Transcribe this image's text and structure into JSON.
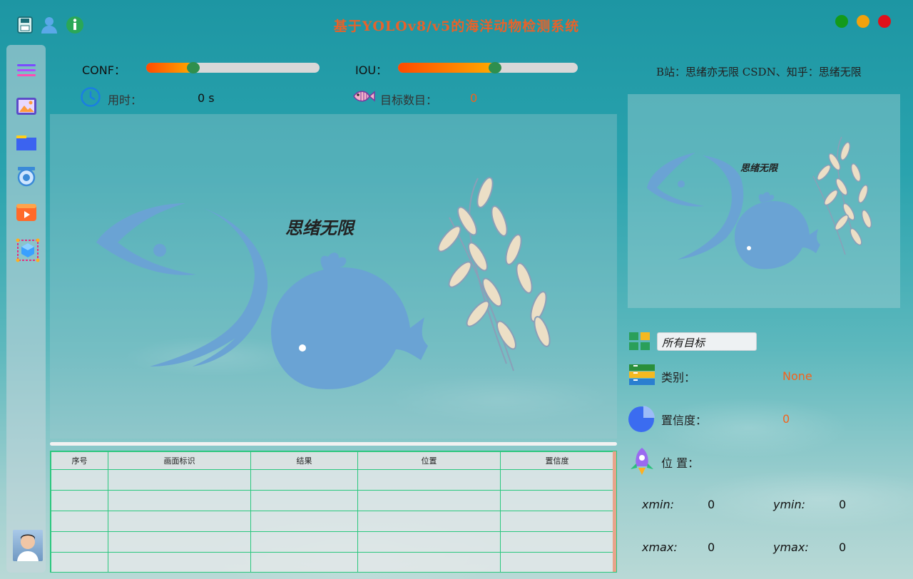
{
  "header": {
    "title": "基于YOLOv8/v5的海洋动物检测系统"
  },
  "window_controls": {
    "colors": {
      "green": "#139a1a",
      "yellow": "#f2a20c",
      "red": "#e0101a"
    }
  },
  "controls": {
    "conf_label": "CONF：",
    "conf_value": 0.27,
    "iou_label": "IOU：",
    "iou_value": 0.54,
    "time_label": "用时：",
    "time_value": "0 s",
    "count_label": "目标数目：",
    "count_value": "0"
  },
  "credit": "B站：思绪亦无限  CSDN、知乎：思绪无限",
  "watermark": "思绪无限",
  "table": {
    "headers": [
      "序号",
      "画面标识",
      "结果",
      "位置",
      "置信度"
    ],
    "row_count": 5
  },
  "detail": {
    "target_select": "所有目标",
    "class_label": "类别：",
    "class_value": "None",
    "conf_label": "置信度：",
    "conf_value": "0",
    "pos_label": "位 置：",
    "xmin_label": "xmin:",
    "xmin_value": "0",
    "ymin_label": "ymin:",
    "ymin_value": "0",
    "xmax_label": "xmax:",
    "xmax_value": "0",
    "ymax_label": "ymax:",
    "ymax_value": "0"
  },
  "sidebar": {
    "items": [
      "menu-icon",
      "image-icon",
      "folder-icon",
      "camera-icon",
      "video-icon",
      "model-icon"
    ]
  }
}
